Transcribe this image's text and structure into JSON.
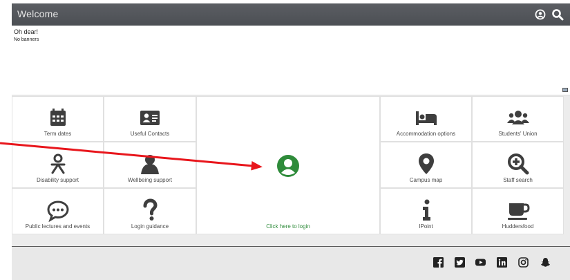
{
  "header": {
    "title": "Welcome",
    "icons": [
      "account-icon",
      "search-icon"
    ]
  },
  "banner": {
    "heading": "Oh dear!",
    "message": "No banners"
  },
  "tiles": {
    "term_dates": "Term dates",
    "useful_contacts": "Useful Contacts",
    "login": "Click here to login",
    "accommodation": "Accommodation options",
    "students_union": "Students' Union",
    "disability": "Disability support",
    "wellbeing": "Wellbeing support",
    "campus_map": "Campus map",
    "staff_search": "Staff search",
    "public_lectures": "Public lectures and events",
    "login_guidance": "Login guidance",
    "ipoint": "IPoint",
    "huddersfood": "Huddersfood"
  },
  "footer": {
    "social": [
      "facebook-icon",
      "twitter-icon",
      "youtube-icon",
      "linkedin-icon",
      "instagram-icon",
      "snapchat-icon"
    ]
  },
  "colors": {
    "header_bg": "#505357",
    "icon_dark": "#3e3e3e",
    "login_green": "#2e8b3a",
    "annotation_arrow": "#e8161c"
  }
}
